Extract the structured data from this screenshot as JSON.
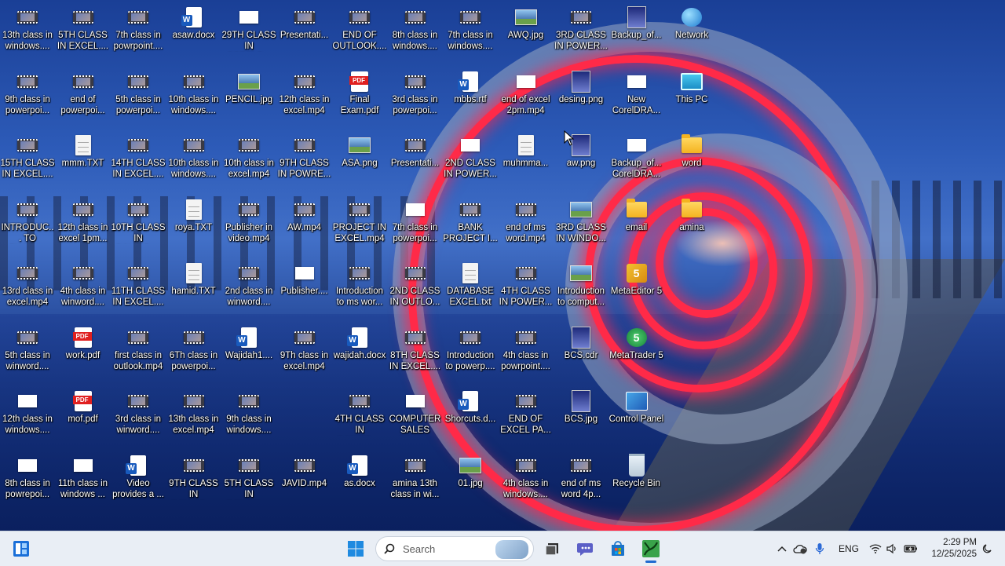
{
  "desktop": {
    "icons": [
      {
        "label": "13th class in windows....",
        "type": "video"
      },
      {
        "label": "5TH CLASS IN EXCEL....",
        "type": "video"
      },
      {
        "label": "7th class in powrpoint....",
        "type": "video"
      },
      {
        "label": "asaw.docx",
        "type": "word"
      },
      {
        "label": "29TH CLASS IN CORELD...",
        "type": "blank"
      },
      {
        "label": "Presentati...",
        "type": "video"
      },
      {
        "label": "END OF OUTLOOK....",
        "type": "video"
      },
      {
        "label": "8th class in windows....",
        "type": "video"
      },
      {
        "label": "7th class in windows....",
        "type": "video"
      },
      {
        "label": "AWQ.jpg",
        "type": "image"
      },
      {
        "label": "3RD CLASS IN POWER...",
        "type": "video"
      },
      {
        "label": "Backup_of...",
        "type": "cdr"
      },
      {
        "label": "Network",
        "type": "network"
      },
      {
        "label": "9th class in powerpoi...",
        "type": "video"
      },
      {
        "label": "end of powerpoi...",
        "type": "video"
      },
      {
        "label": "5th class in powerpoi...",
        "type": "video"
      },
      {
        "label": "10th class in windows....",
        "type": "video"
      },
      {
        "label": "PENCIL.jpg",
        "type": "image"
      },
      {
        "label": "12th class in excel.mp4",
        "type": "video"
      },
      {
        "label": "Final Exam.pdf",
        "type": "pdf"
      },
      {
        "label": "3rd class in powerpoi...",
        "type": "video"
      },
      {
        "label": "mbbs.rtf",
        "type": "word"
      },
      {
        "label": "end of excel 2pm.mp4",
        "type": "blank"
      },
      {
        "label": "desing.png",
        "type": "cdr"
      },
      {
        "label": "New CorelDRA...",
        "type": "blank"
      },
      {
        "label": "This PC",
        "type": "pc"
      },
      {
        "label": "15TH CLASS IN EXCEL....",
        "type": "video"
      },
      {
        "label": "mmm.TXT",
        "type": "text"
      },
      {
        "label": "14TH CLASS IN EXCEL....",
        "type": "video"
      },
      {
        "label": "10th class in windows....",
        "type": "video"
      },
      {
        "label": "10th class in excel.mp4",
        "type": "video"
      },
      {
        "label": "9TH CLASS IN POWRE...",
        "type": "video"
      },
      {
        "label": "ASA.png",
        "type": "image"
      },
      {
        "label": "Presentati...",
        "type": "video"
      },
      {
        "label": "2ND CLASS IN POWER...",
        "type": "blank"
      },
      {
        "label": "muhmma...",
        "type": "text"
      },
      {
        "label": "aw.png",
        "type": "cdr"
      },
      {
        "label": "Backup_of... CorelDRA...",
        "type": "blank"
      },
      {
        "label": "word",
        "type": "folder"
      },
      {
        "label": "INTRODUC... TO EXCEL...",
        "type": "video"
      },
      {
        "label": "12th class in excel 1pm...",
        "type": "video"
      },
      {
        "label": "10TH CLASS IN POWER....",
        "type": "video"
      },
      {
        "label": "roya.TXT",
        "type": "text"
      },
      {
        "label": "Publisher in video.mp4",
        "type": "video"
      },
      {
        "label": "AW.mp4",
        "type": "video"
      },
      {
        "label": "PROJECT IN EXCEL.mp4",
        "type": "video"
      },
      {
        "label": "7th class in powerpoi...",
        "type": "blank"
      },
      {
        "label": "BANK PROJECT I...",
        "type": "video"
      },
      {
        "label": "end of ms word.mp4",
        "type": "video"
      },
      {
        "label": "3RD CLASS IN WINDO...",
        "type": "image"
      },
      {
        "label": "email",
        "type": "folder"
      },
      {
        "label": "amina",
        "type": "folder"
      },
      {
        "label": "13rd class in excel.mp4",
        "type": "video"
      },
      {
        "label": "4th class in winword....",
        "type": "video"
      },
      {
        "label": "11TH CLASS IN EXCEL....",
        "type": "video"
      },
      {
        "label": "hamid.TXT",
        "type": "text"
      },
      {
        "label": "2nd class in winword....",
        "type": "video"
      },
      {
        "label": "Publisher....",
        "type": "blank"
      },
      {
        "label": "Introduction to ms wor...",
        "type": "video"
      },
      {
        "label": "2ND CLASS IN OUTLO...",
        "type": "video"
      },
      {
        "label": "DATABASE EXCEL.txt",
        "type": "text"
      },
      {
        "label": "4TH CLASS IN POWER...",
        "type": "video"
      },
      {
        "label": "Introduction to comput...",
        "type": "image"
      },
      {
        "label": "MetaEditor 5",
        "type": "metaeditor"
      },
      {
        "label": "5th class in winword....",
        "type": "video"
      },
      {
        "label": "work.pdf",
        "type": "pdf"
      },
      {
        "label": "first class in outlook.mp4",
        "type": "video"
      },
      {
        "label": "6Th class in powerpoi...",
        "type": "video"
      },
      {
        "label": "Wajidah1....",
        "type": "word"
      },
      {
        "label": "9Th class in excel.mp4",
        "type": "video"
      },
      {
        "label": "wajidah.docx",
        "type": "word"
      },
      {
        "label": "8TH CLASS IN EXCEL....",
        "type": "video"
      },
      {
        "label": "Introduction to powerp....",
        "type": "video"
      },
      {
        "label": "4th class in powrpoint....",
        "type": "video"
      },
      {
        "label": "BCS.cdr",
        "type": "cdr"
      },
      {
        "label": "MetaTrader 5",
        "type": "metatrader"
      },
      {
        "label": "12th class in windows....",
        "type": "blank"
      },
      {
        "label": "mof.pdf",
        "type": "pdf"
      },
      {
        "label": "3rd class in winword....",
        "type": "video"
      },
      {
        "label": "13th class in excel.mp4",
        "type": "video"
      },
      {
        "label": "9th class in windows....",
        "type": "video"
      },
      {
        "label": "4TH CLASS IN POWER....",
        "type": "video"
      },
      {
        "label": "COMPUTER SALES PROJ...",
        "type": "blank"
      },
      {
        "label": "Shorcuts.d...",
        "type": "word"
      },
      {
        "label": "END OF EXCEL PA...",
        "type": "video"
      },
      {
        "label": "BCS.jpg",
        "type": "cdr"
      },
      {
        "label": "Control Panel",
        "type": "control"
      },
      {
        "label": "8th class in powrepoi...",
        "type": "blank"
      },
      {
        "label": "11th class in windows ...",
        "type": "blank"
      },
      {
        "label": "Video provides a ...",
        "type": "word"
      },
      {
        "label": "9TH CLASS IN POWER....",
        "type": "video"
      },
      {
        "label": "5TH CLASS IN POWER....",
        "type": "video"
      },
      {
        "label": "JAVID.mp4",
        "type": "video"
      },
      {
        "label": "as.docx",
        "type": "word"
      },
      {
        "label": "amina 13th class in wi...",
        "type": "video"
      },
      {
        "label": "01.jpg",
        "type": "image"
      },
      {
        "label": "4th class in windows....",
        "type": "video"
      },
      {
        "label": "end of ms word 4p...",
        "type": "video"
      },
      {
        "label": "Recycle Bin",
        "type": "recycle"
      }
    ]
  },
  "taskbar": {
    "search_placeholder": "Search",
    "apps": [
      "widgets",
      "start",
      "search",
      "task-view",
      "teams-chat",
      "microsoft-store",
      "coreldraw"
    ],
    "tray": {
      "language": "ENG",
      "time": "2:29 PM",
      "date": "12/25/2025"
    }
  },
  "colors": {
    "taskbar_bg": "#e9eef5",
    "accent": "#1f6ad0",
    "ring_red": "#ff2a48"
  }
}
